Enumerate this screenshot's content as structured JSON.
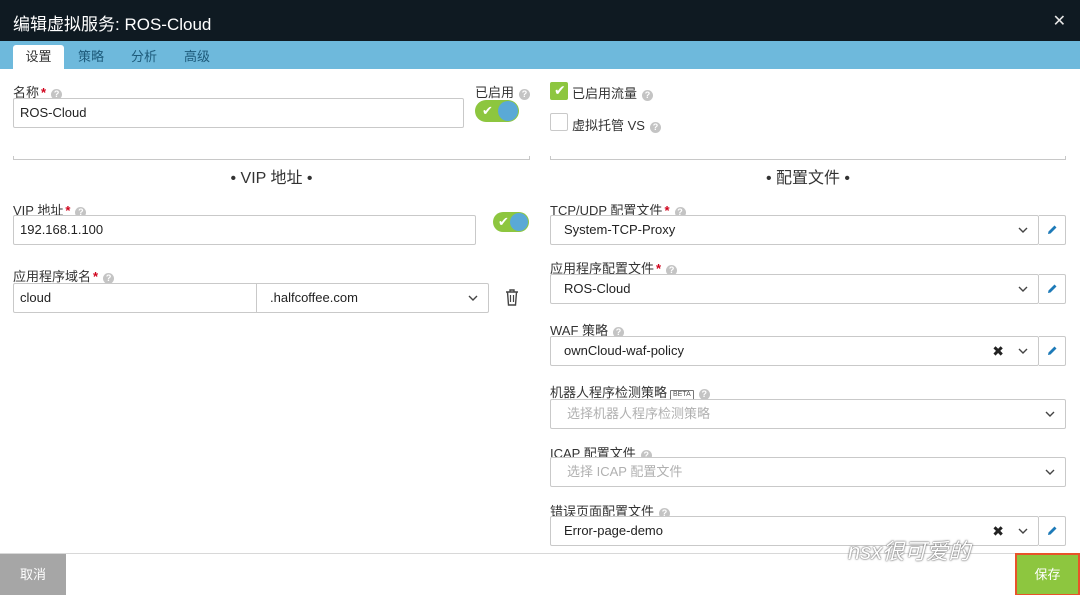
{
  "window": {
    "title": "编辑虚拟服务: ROS-Cloud",
    "close_icon": "close-icon"
  },
  "tabs": [
    {
      "label": "设置",
      "active": true
    },
    {
      "label": "策略",
      "active": false
    },
    {
      "label": "分析",
      "active": false
    },
    {
      "label": "高级",
      "active": false
    }
  ],
  "name": {
    "label": "名称",
    "required": "*",
    "value": "ROS-Cloud"
  },
  "enabled": {
    "label": "已启用",
    "checked": true
  },
  "traffic_enabled": {
    "label": "已启用流量",
    "checked": true
  },
  "virtual_hosting": {
    "label": "虚拟托管 VS",
    "checked": false
  },
  "vip_section": {
    "title": "• VIP 地址 •"
  },
  "vip": {
    "label": "VIP 地址",
    "required": "*",
    "value": "192.168.1.100",
    "enabled": true
  },
  "app_domain": {
    "label": "应用程序域名",
    "required": "*",
    "host": "cloud",
    "domain": ".halfcoffee.com"
  },
  "profile_section": {
    "title": "• 配置文件 •"
  },
  "tcp_udp_profile": {
    "label": "TCP/UDP 配置文件",
    "required": "*",
    "value": "System-TCP-Proxy"
  },
  "app_profile": {
    "label": "应用程序配置文件",
    "required": "*",
    "value": "ROS-Cloud"
  },
  "waf_policy": {
    "label": "WAF 策略",
    "value": "ownCloud-waf-policy"
  },
  "bot_policy": {
    "label": "机器人程序检测策略",
    "badge": "BETA",
    "placeholder": "选择机器人程序检测策略"
  },
  "icap_profile": {
    "label": "ICAP 配置文件",
    "placeholder": "选择 ICAP 配置文件"
  },
  "error_page_profile": {
    "label": "错误页面配置文件",
    "value": "Error-page-demo"
  },
  "footer": {
    "cancel_label": "取消",
    "save_label": "保存"
  },
  "watermark": "nsx很可爱的",
  "colors": {
    "titlebar": "#0f1a22",
    "tabbar": "#6eb9dc",
    "accent_green": "#8dc63f",
    "toggle_knob": "#5aa9d6",
    "cancel": "#a6a6a6",
    "save_outline": "#e8532a"
  }
}
